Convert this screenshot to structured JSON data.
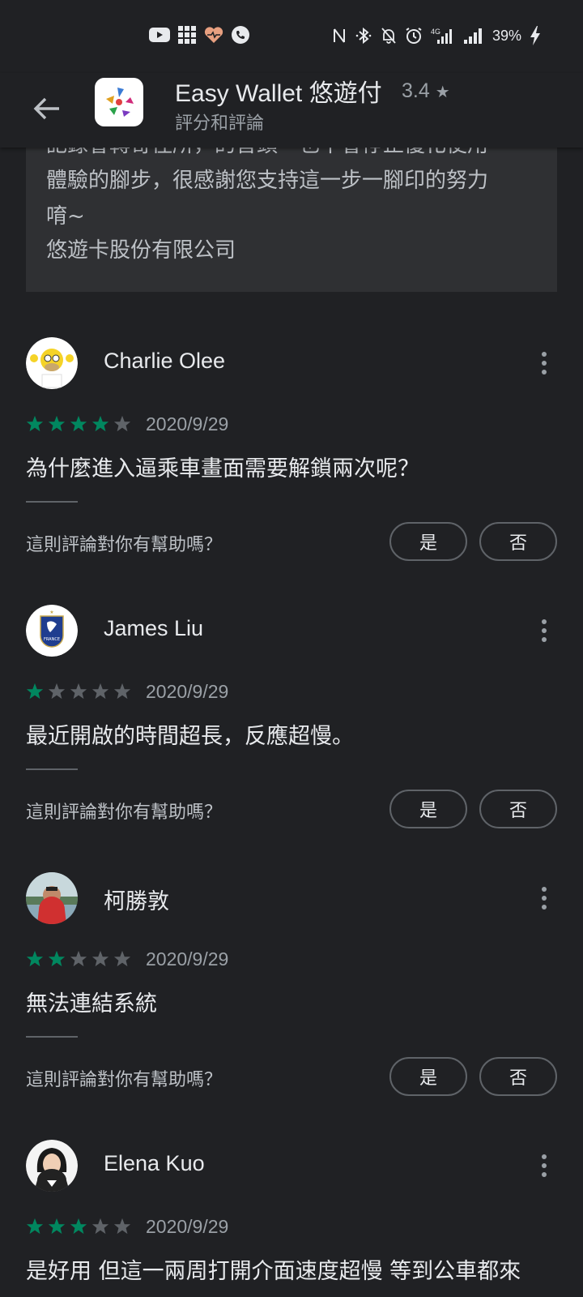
{
  "status_bar": {
    "battery": "39%",
    "left_icons": [
      "youtube-icon",
      "grid-icon",
      "heart-icon",
      "phone-icon"
    ],
    "right_icons": [
      "nfc-icon",
      "bluetooth-icon",
      "mute-icon",
      "alarm-icon",
      "4g-signal-icon",
      "signal-icon",
      "battery-charging-icon"
    ]
  },
  "app_bar": {
    "title": "Easy Wallet 悠遊付",
    "rating": "3.4",
    "subtitle": "評分和評論"
  },
  "developer_reply": {
    "lines": [
      "記錄會轉寄徑所，的音頭一也不會停止優化使用",
      "體驗的腳步，很感謝您支持這一步一腳印的努力",
      "唷~",
      "悠遊卡股份有限公司"
    ]
  },
  "reviews": [
    {
      "name": "Charlie Olee",
      "rating": 4,
      "date": "2020/9/29",
      "text": "為什麼進入逼乘車畫面需要解鎖兩次呢？",
      "helpful_q": "這則評論對你有幫助嗎？",
      "yes": "是",
      "no": "否"
    },
    {
      "name": "James Liu",
      "rating": 1,
      "date": "2020/9/29",
      "text": "最近開啟的時間超長，反應超慢。",
      "helpful_q": "這則評論對你有幫助嗎？",
      "yes": "是",
      "no": "否"
    },
    {
      "name": "柯勝敦",
      "rating": 2,
      "date": "2020/9/29",
      "text": "無法連結系統",
      "helpful_q": "這則評論對你有幫助嗎？",
      "yes": "是",
      "no": "否"
    },
    {
      "name": "Elena Kuo",
      "rating": 3,
      "date": "2020/9/29",
      "text": "是好用 但這一兩周打開介面速度超慢 等到公車都來",
      "helpful_q": "",
      "yes": "",
      "no": ""
    }
  ],
  "colors": {
    "star_filled": "#01875f",
    "star_empty": "#5f6368",
    "background": "#202124"
  }
}
